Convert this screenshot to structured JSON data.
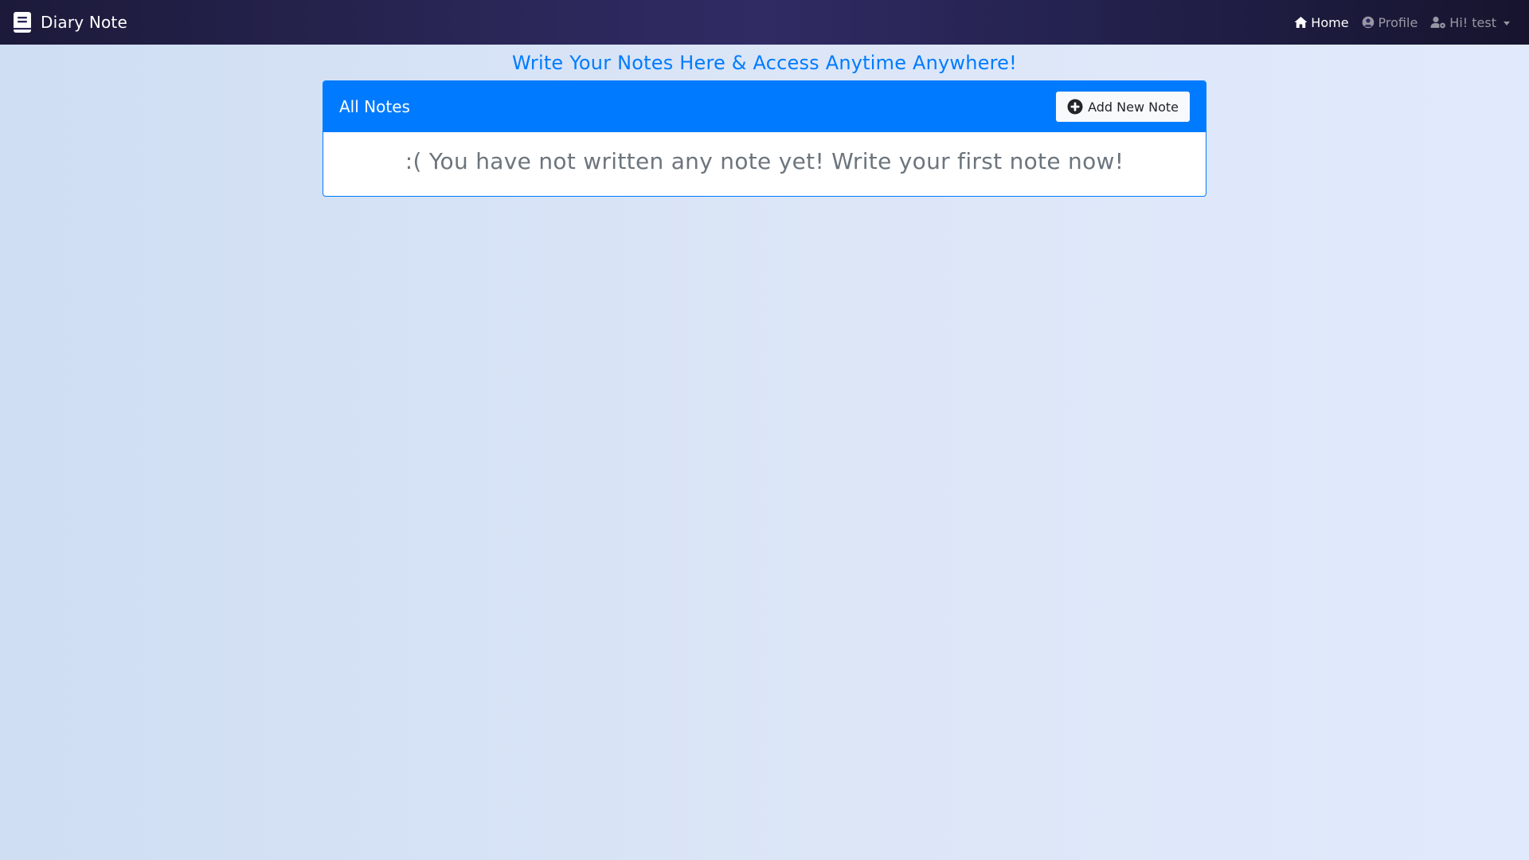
{
  "navbar": {
    "brand": "Diary Note",
    "brand_icon": "book-icon",
    "links": [
      {
        "label": "Home",
        "icon": "home-icon",
        "active": true
      },
      {
        "label": "Profile",
        "icon": "user-circle-icon",
        "active": false
      },
      {
        "label": "Hi! test",
        "icon": "user-cog-icon",
        "active": false,
        "dropdown": true
      }
    ]
  },
  "headline": "Write Your Notes Here & Access Anytime Anywhere!",
  "notes_card": {
    "title": "All Notes",
    "add_button_label": "Add New Note",
    "add_button_icon": "plus-circle-icon",
    "empty_message": ":( You have not written any note yet! Write your first note now!"
  },
  "colors": {
    "primary": "#007bff",
    "navbar_dark": "#302b63",
    "muted_text": "#6c757d",
    "page_bg": "#dce6f7"
  }
}
